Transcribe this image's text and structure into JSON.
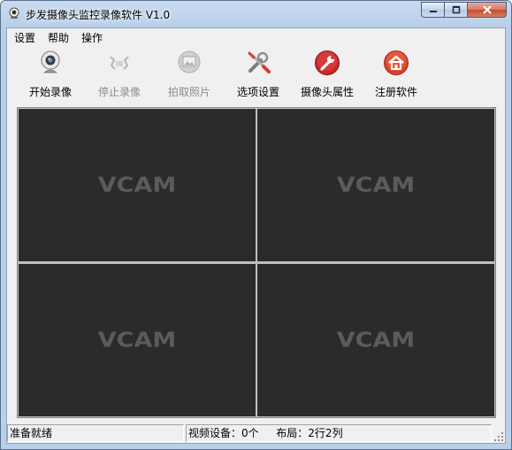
{
  "window": {
    "title": "步发摄像头监控录像软件 V1.0",
    "controls": {
      "minimize": "minimize",
      "maximize": "maximize",
      "close": "close"
    }
  },
  "menu": [
    "设置",
    "帮助",
    "操作"
  ],
  "toolbar": {
    "buttons": [
      {
        "label": "开始录像",
        "icon": "webcam-icon",
        "enabled": true
      },
      {
        "label": "停止录像",
        "icon": "stop-record-icon",
        "enabled": false
      },
      {
        "label": "拍取照片",
        "icon": "photo-icon",
        "enabled": false
      },
      {
        "label": "选项设置",
        "icon": "tools-icon",
        "enabled": true
      },
      {
        "label": "摄像头属性",
        "icon": "wrench-icon",
        "enabled": true
      },
      {
        "label": "注册软件",
        "icon": "home-icon",
        "enabled": true
      }
    ]
  },
  "video_grid": {
    "rows": 2,
    "cols": 2,
    "watermark": "VCAM",
    "background": "#2b2b2b"
  },
  "status": {
    "ready": "准备就绪",
    "devices": "视频设备：0个",
    "layout": "布局：2行2列"
  },
  "colors": {
    "accent_red": "#c62828",
    "titlebar": "#c8daef"
  }
}
